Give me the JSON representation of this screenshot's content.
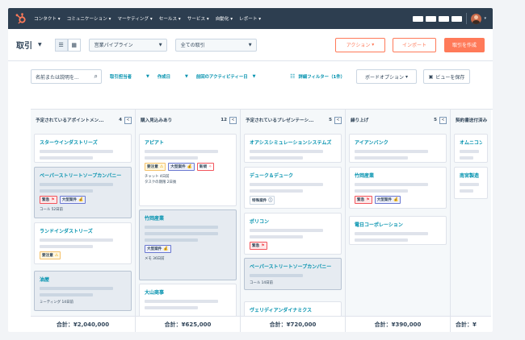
{
  "nav": {
    "items": [
      "コンタクト",
      "コミュニケーション",
      "マーケティング",
      "セールス",
      "サービス",
      "自動化",
      "レポート"
    ]
  },
  "header": {
    "title": "取引",
    "pipeline_select": "営業パイプライン",
    "deals_select": "全ての取引",
    "actions_button": "アクション",
    "import_button": "インポート",
    "create_button": "取引を作成"
  },
  "filters": {
    "search_placeholder": "名前または説明を...",
    "owner": "取引担当者",
    "created": "作成日",
    "last_activity": "前回のアクティビティー日",
    "advanced": "詳細フィルター（1件）",
    "board_options": "ボードオプション",
    "save_view": "ビューを保存"
  },
  "columns": [
    {
      "title": "予定されているアポイントメン...",
      "count": "4",
      "total": "合計：¥2,040,000",
      "cards": [
        {
          "name": "スターウインダストリーズ",
          "tags": []
        },
        {
          "name": "ペーパーストリートソープカンパニー",
          "tags": [
            {
              "label": "緊急",
              "type": "urgent"
            },
            {
              "label": "大型案件",
              "type": "large"
            }
          ],
          "meta": [
            "コール 52日前"
          ]
        },
        {
          "name": "ランドインダストリーズ",
          "tags": [
            {
              "label": "要注意",
              "type": "warn"
            }
          ]
        },
        {
          "name": "油屋",
          "tags": [],
          "meta": [
            "ミーティング 14日前"
          ]
        }
      ]
    },
    {
      "title": "購入見込みあり",
      "count": "12",
      "total": "合計：¥625,000",
      "cards": [
        {
          "name": "アピアト",
          "tags": [
            {
              "label": "要注意",
              "type": "warn"
            },
            {
              "label": "大型案件",
              "type": "large"
            },
            {
              "label": "新規",
              "type": "new"
            }
          ],
          "meta": [
            "チャット 4日前",
            "タスクの期限 2日後"
          ]
        },
        {
          "name": "竹岡産業",
          "tags": [
            {
              "label": "大型案件",
              "type": "large"
            }
          ],
          "meta": [
            "メモ 36日前"
          ]
        },
        {
          "name": "大山商事",
          "tags": []
        }
      ]
    },
    {
      "title": "予定されているプレゼンテーシ...",
      "count": "5",
      "total": "合計：¥720,000",
      "cards": [
        {
          "name": "オアシスシミュレーションシステムズ",
          "tags": []
        },
        {
          "name": "デューク＆デューク",
          "tags": [
            {
              "label": "特殊案件",
              "type": "special"
            }
          ]
        },
        {
          "name": "ポリコン",
          "tags": [
            {
              "label": "緊急",
              "type": "urgent"
            }
          ]
        },
        {
          "name": "ペーパーストリートソープカンパニー",
          "tags": [],
          "meta": [
            "コール 14日前"
          ]
        },
        {
          "name": "ヴェリディアンダイナミクス",
          "tags": []
        }
      ]
    },
    {
      "title": "繰り上げ",
      "count": "5",
      "total": "合計：¥390,000",
      "cards": [
        {
          "name": "アイアンバンク",
          "tags": []
        },
        {
          "name": "竹岡産業",
          "tags": [
            {
              "label": "緊急",
              "type": "urgent"
            },
            {
              "label": "大型案件",
              "type": "large"
            }
          ]
        },
        {
          "name": "電日コーポレーション",
          "tags": []
        }
      ]
    },
    {
      "title": "契約書送付済み",
      "count": "",
      "total": "合計：¥",
      "cards": [
        {
          "name": "オムニコンシュ",
          "tags": []
        },
        {
          "name": "南宮製造",
          "tags": []
        }
      ]
    }
  ],
  "tag_icons": {
    "urgent": "flag-icon",
    "large": "moneybag-icon",
    "warn": "warning-icon",
    "new": "sparkle-icon",
    "special": "info-icon"
  }
}
